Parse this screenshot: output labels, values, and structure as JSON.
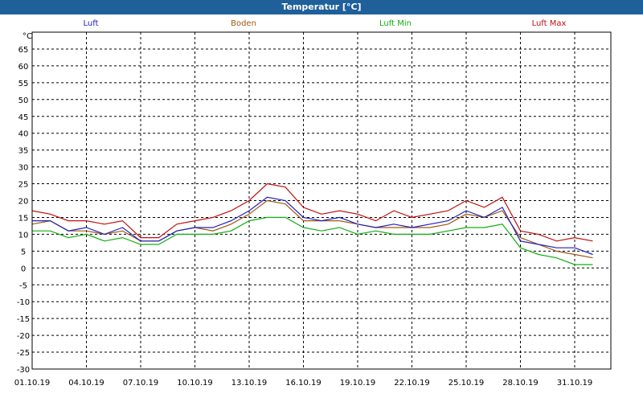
{
  "window": {
    "title": "Temperatur [°C]"
  },
  "colors": {
    "title_bar": "#1f5f9a",
    "grid": "#000000",
    "Luft": "#2020c0",
    "Boden": "#a05a10",
    "Luft Min": "#10b010",
    "Luft Max": "#c01010"
  },
  "chart_data": {
    "type": "line",
    "title": "Temperatur [°C]",
    "ylabel": "°C",
    "xlabel": "",
    "ylim": [
      -30,
      70
    ],
    "xlim": [
      "01.10.19",
      "02.11.19"
    ],
    "y_ticks": [
      65,
      60,
      55,
      50,
      45,
      40,
      35,
      30,
      25,
      20,
      15,
      10,
      5,
      0,
      -5,
      -10,
      -15,
      -20,
      -25,
      -30
    ],
    "x_ticks": [
      "01.10.19",
      "04.10.19",
      "07.10.19",
      "10.10.19",
      "13.10.19",
      "16.10.19",
      "19.10.19",
      "22.10.19",
      "25.10.19",
      "28.10.19",
      "31.10.19"
    ],
    "grid": true,
    "legend_position": "top",
    "x": [
      "01.10.19",
      "02.10.19",
      "03.10.19",
      "04.10.19",
      "05.10.19",
      "06.10.19",
      "07.10.19",
      "08.10.19",
      "09.10.19",
      "10.10.19",
      "11.10.19",
      "12.10.19",
      "13.10.19",
      "14.10.19",
      "15.10.19",
      "16.10.19",
      "17.10.19",
      "18.10.19",
      "19.10.19",
      "20.10.19",
      "21.10.19",
      "22.10.19",
      "23.10.19",
      "24.10.19",
      "25.10.19",
      "26.10.19",
      "27.10.19",
      "28.10.19",
      "29.10.19",
      "30.10.19",
      "31.10.19",
      "01.11.19"
    ],
    "series": [
      {
        "name": "Luft",
        "values": [
          14,
          14,
          11,
          12,
          10,
          12,
          8,
          8,
          11,
          12,
          12,
          14,
          17,
          21,
          20,
          15,
          14,
          15,
          13,
          12,
          13,
          12,
          13,
          14,
          17,
          15,
          18,
          8,
          7,
          6,
          6,
          4
        ]
      },
      {
        "name": "Boden",
        "values": [
          13,
          14,
          11,
          11,
          10,
          11,
          8,
          8,
          11,
          12,
          11,
          13,
          16,
          20,
          19,
          14,
          14,
          14,
          13,
          12,
          12,
          12,
          12,
          13,
          16,
          15,
          17,
          9,
          7,
          5,
          4,
          3
        ]
      },
      {
        "name": "Luft Min",
        "values": [
          11,
          11,
          9,
          10,
          8,
          9,
          7,
          7,
          10,
          10,
          10,
          11,
          14,
          15,
          15,
          12,
          11,
          12,
          10,
          11,
          10,
          10,
          10,
          11,
          12,
          12,
          13,
          6,
          4,
          3,
          1,
          1
        ]
      },
      {
        "name": "Luft Max",
        "values": [
          17,
          16,
          14,
          14,
          13,
          14,
          9,
          9,
          13,
          14,
          15,
          17,
          20,
          25,
          24,
          18,
          16,
          17,
          16,
          14,
          17,
          15,
          16,
          17,
          20,
          18,
          21,
          11,
          10,
          8,
          9,
          8
        ]
      }
    ]
  }
}
